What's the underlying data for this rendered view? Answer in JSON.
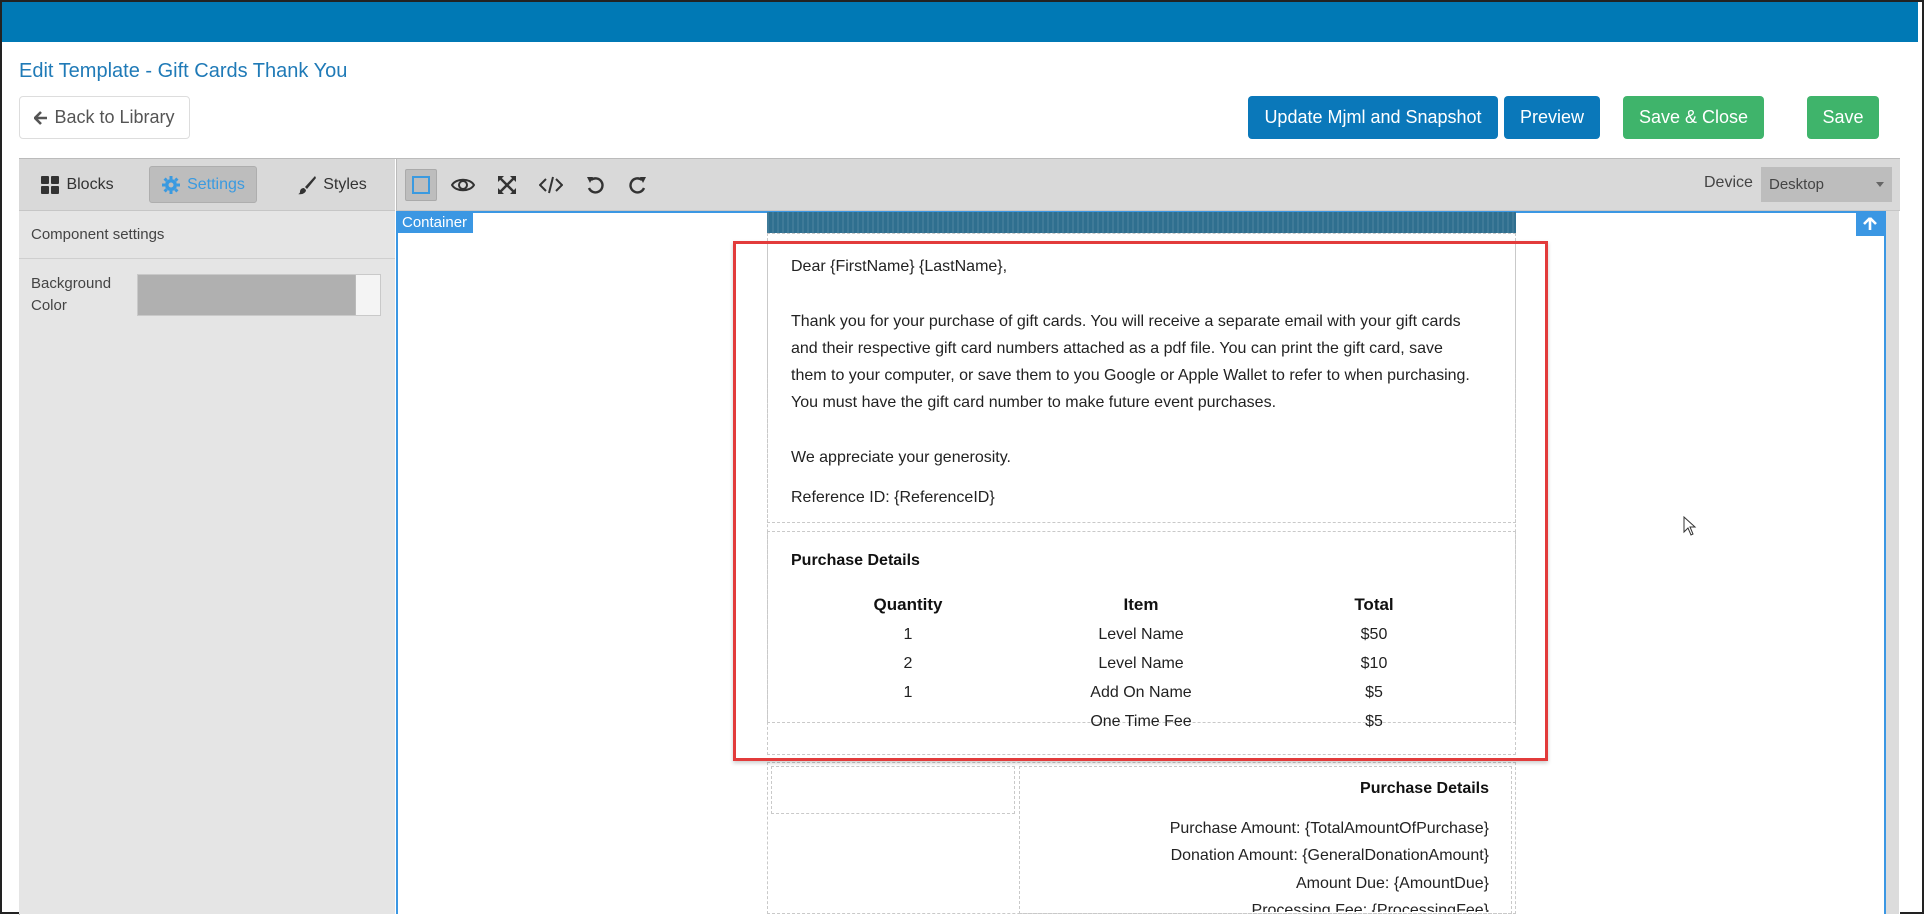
{
  "header": {
    "title": "Edit Template - Gift Cards Thank You",
    "back_label": "Back to Library",
    "buttons": {
      "update_mjml": "Update Mjml and Snapshot",
      "preview": "Preview",
      "save_close": "Save & Close",
      "save": "Save"
    }
  },
  "left_panel": {
    "tabs": [
      {
        "label": "Blocks",
        "icon": "grid-icon"
      },
      {
        "label": "Settings",
        "icon": "gear-icon",
        "active": true
      },
      {
        "label": "Styles",
        "icon": "brush-icon"
      }
    ],
    "component_settings": "Component settings",
    "background_color_label": "Background Color"
  },
  "toolbar": {
    "tools": [
      "square-outline-icon",
      "eye-icon",
      "fullscreen-icon",
      "code-icon",
      "undo-icon",
      "redo-icon"
    ],
    "device_label": "Device",
    "device_value": "Desktop"
  },
  "canvas": {
    "container_badge": "Container",
    "greeting": "Dear {FirstName} {LastName},",
    "body_lines": [
      "Thank you for your purchase of gift cards. You will receive a separate email with your gift cards",
      "and their respective gift card numbers attached as a pdf file. You can print the gift card, save",
      "them to your computer, or save them to you Google or Apple Wallet to refer to when purchasing.",
      "You must have the gift card number to make future event purchases."
    ],
    "appreciation": "We appreciate your generosity.",
    "reference": "Reference ID: {ReferenceID}",
    "purchase_details": {
      "title": "Purchase Details",
      "columns": [
        "Quantity",
        "Item",
        "Total"
      ],
      "rows": [
        [
          "1",
          "Level Name",
          "$50"
        ],
        [
          "2",
          "Level Name",
          "$10"
        ],
        [
          "1",
          "Add On Name",
          "$5"
        ],
        [
          "",
          "One Time Fee",
          "$5"
        ]
      ]
    },
    "summary": {
      "title": "Purchase Details",
      "lines": [
        "Purchase Amount: {TotalAmountOfPurchase}",
        "Donation Amount: {GeneralDonationAmount}",
        "Amount Due: {AmountDue}",
        "Processing Fee: {ProcessingFee}"
      ]
    }
  },
  "colors": {
    "topbar": "#0079b5",
    "primary_button": "#0a78ba",
    "success_button": "#3fb46b",
    "selection": "#3b97e3",
    "highlight_box": "#e23b3b"
  }
}
